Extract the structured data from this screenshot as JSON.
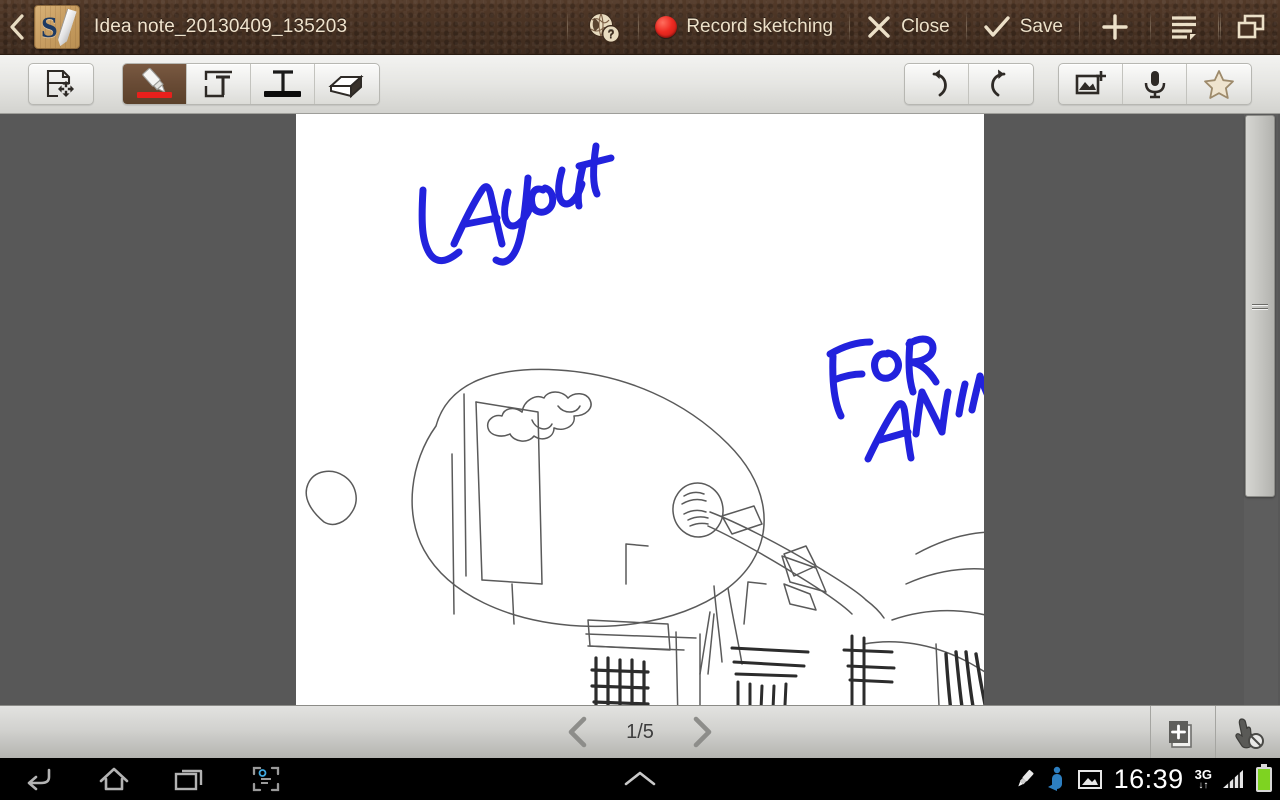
{
  "titlebar": {
    "back_label": "Back",
    "app_icon": "snote-icon",
    "document_title": "Idea note_20130409_135203",
    "help_icon": "globe-help-icon",
    "record_label": "Record sketching",
    "record_icon": "record-dot-icon",
    "close_label": "Close",
    "close_icon": "close-x-icon",
    "save_label": "Save",
    "save_icon": "check-icon",
    "add_icon": "plus-icon",
    "menu_icon": "list-menu-icon",
    "multiwindow_icon": "multi-window-icon"
  },
  "toolbar": {
    "select_tool": {
      "name": "select-move-tool",
      "icon": "select-move-icon",
      "active": false
    },
    "pen_tool": {
      "name": "pen-tool",
      "icon": "pen-icon",
      "active": true,
      "color": "#e8201c"
    },
    "textbox_tool": {
      "name": "text-box-tool",
      "icon": "text-box-icon",
      "active": false
    },
    "text_tool": {
      "name": "text-tool",
      "icon": "text-underline-icon",
      "active": false,
      "color": "#0b0b0b"
    },
    "eraser_tool": {
      "name": "eraser-tool",
      "icon": "eraser-icon",
      "active": false
    },
    "undo": {
      "name": "undo-button",
      "icon": "undo-arrow-icon"
    },
    "redo": {
      "name": "redo-button",
      "icon": "redo-arrow-icon"
    },
    "insert_image": {
      "name": "insert-image-button",
      "icon": "image-plus-icon"
    },
    "voice_record": {
      "name": "voice-record-button",
      "icon": "microphone-icon"
    },
    "favorite": {
      "name": "favorite-button",
      "icon": "star-icon"
    }
  },
  "canvas": {
    "background": "#ffffff",
    "ink_color": "#2222dd",
    "pencil_color": "#555555",
    "handwriting_text": "LAyout FoR ANIMATION !",
    "sketch_description": "pencil sketch of an airplane flying over a city skyline with clouds and swooping vapour trails"
  },
  "pagebar": {
    "prev_icon": "chevron-left-icon",
    "page_indicator": "1/5",
    "next_icon": "chevron-right-icon",
    "add_page_icon": "add-page-icon",
    "touch_lock_icon": "finger-disabled-icon"
  },
  "scrollbar": {
    "name": "vertical-scrollbar",
    "grip_icon": "grip-lines-icon"
  },
  "systembar": {
    "back_icon": "android-back-icon",
    "home_icon": "android-home-icon",
    "recents_icon": "android-recents-icon",
    "screenshot_icon": "screen-capture-icon",
    "expand_icon": "chevron-up-icon",
    "pen_status_icon": "stylus-icon",
    "spen_status_icon": "spen-detach-icon",
    "image_status_icon": "screenshot-saved-icon",
    "clock": "16:39",
    "network_type": "3G",
    "network_arrows": "↓↑",
    "signal_icon": "signal-bars-icon",
    "battery_icon": "battery-icon",
    "battery_color": "#7ed321"
  },
  "colors": {
    "titlebar_bg": "#473122",
    "titlebar_text": "#ece0c8",
    "toolbar_bg": "#e6e6e3",
    "active_tool_bg": "#6a4c36",
    "workarea_bg": "#585858",
    "pagebar_bg": "#d2d2cf",
    "navbar_bg": "#000000"
  }
}
